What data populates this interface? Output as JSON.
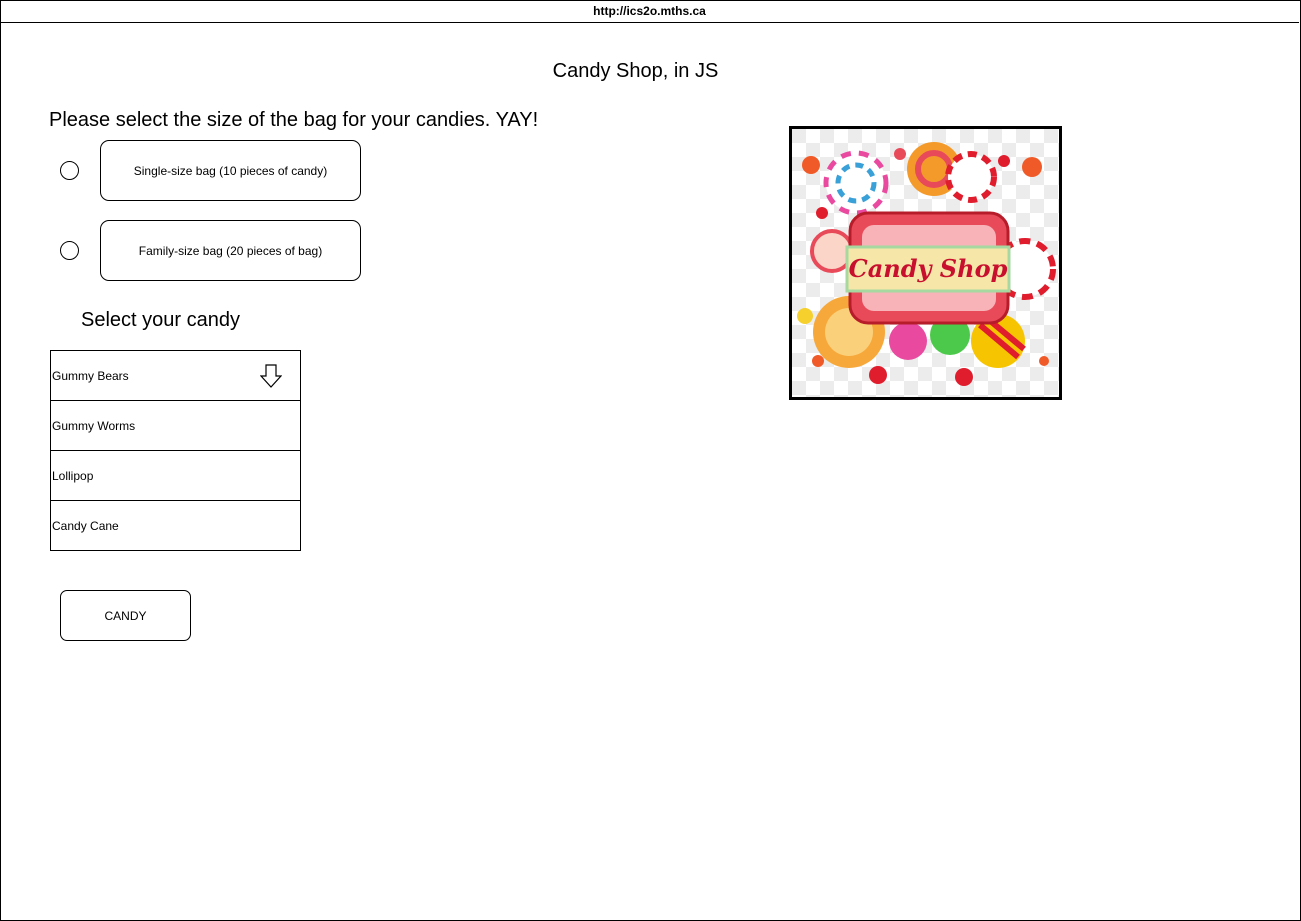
{
  "browser": {
    "url": "http://ics2o.mths.ca"
  },
  "page": {
    "title": "Candy Shop, in JS",
    "bag_prompt": "Please select the size of the bag for your candies. YAY!",
    "bag_options": [
      {
        "label": "Single-size bag (10 pieces of candy)"
      },
      {
        "label": "Family-size bag (20 pieces of bag)"
      }
    ],
    "candy_prompt": "Select your candy",
    "candy_options": [
      "Gummy Bears",
      "Gummy Worms",
      "Lollipop",
      "Candy Cane"
    ],
    "dropdown_icon": "down-arrow-icon",
    "submit_label": "CANDY",
    "logo": {
      "text": "Candy Shop",
      "accent": "#c8102e",
      "banner_fill": "#f6e7a9",
      "frame_fill": "#e94a5a"
    }
  }
}
